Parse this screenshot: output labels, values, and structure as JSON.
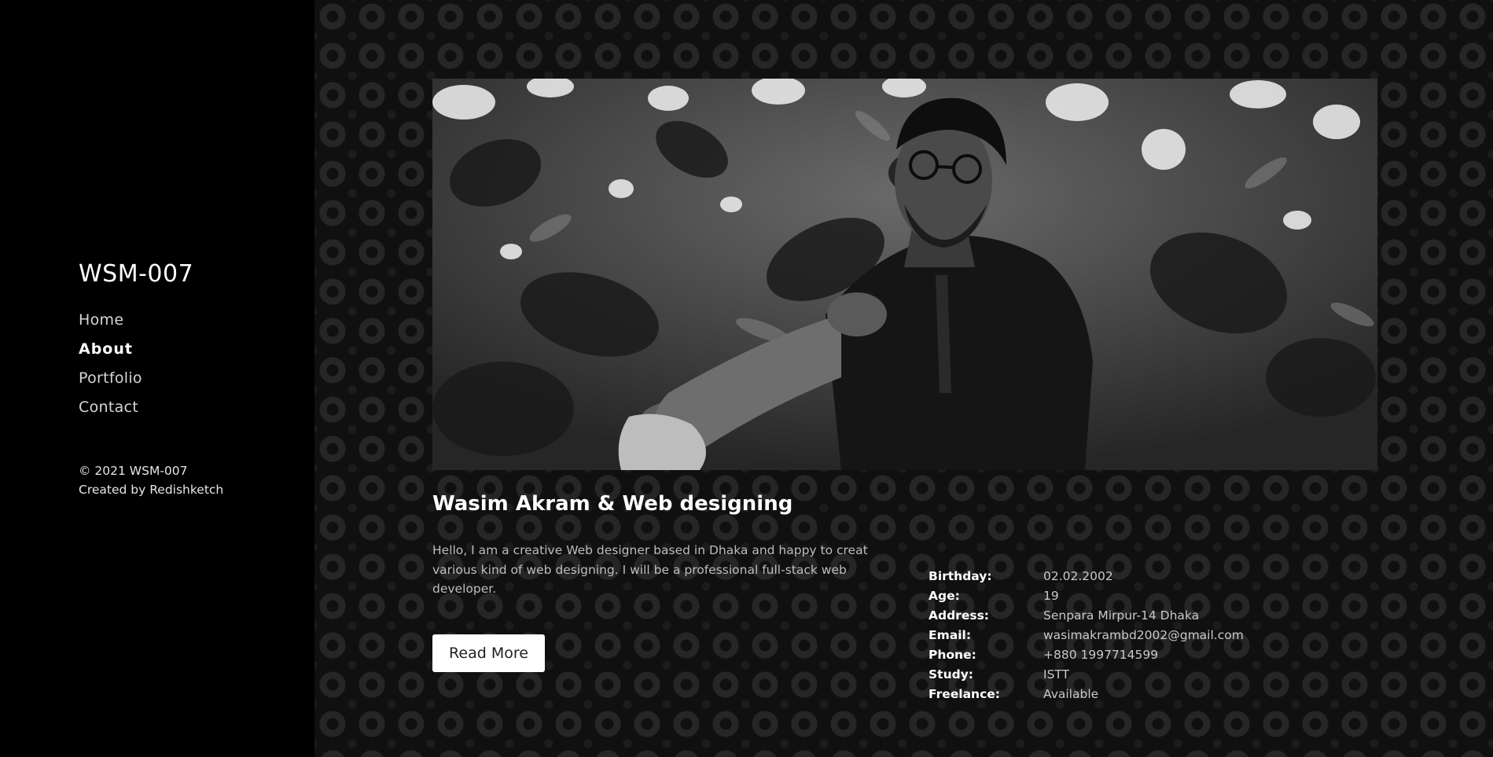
{
  "brand": "WSM-007",
  "nav": [
    {
      "label": "Home",
      "active": false
    },
    {
      "label": "About",
      "active": true
    },
    {
      "label": "Portfolio",
      "active": false
    },
    {
      "label": "Contact",
      "active": false
    }
  ],
  "footer": {
    "copyright": "© 2021 WSM-007",
    "created_prefix": "Created by",
    "creator": "Redishketch"
  },
  "about": {
    "heading": "Wasim Akram & Web designing",
    "intro": "Hello, I am a creative Web designer based in Dhaka and happy to creat various kind of web designing. I will be a professional full-stack web developer.",
    "read_more_label": "Read More"
  },
  "info": [
    {
      "key": "Birthday:",
      "value": "02.02.2002"
    },
    {
      "key": "Age:",
      "value": "19"
    },
    {
      "key": "Address:",
      "value": "Senpara Mirpur-14 Dhaka"
    },
    {
      "key": "Email:",
      "value": "wasimakrambd2002@gmail.com"
    },
    {
      "key": "Phone:",
      "value": "+880 1997714599"
    },
    {
      "key": "Study:",
      "value": "ISTT"
    },
    {
      "key": "Freelance:",
      "value": "Available"
    }
  ],
  "colors": {
    "sidebar_bg": "#000000",
    "main_bg": "#101010",
    "button_bg": "#ffffff"
  }
}
